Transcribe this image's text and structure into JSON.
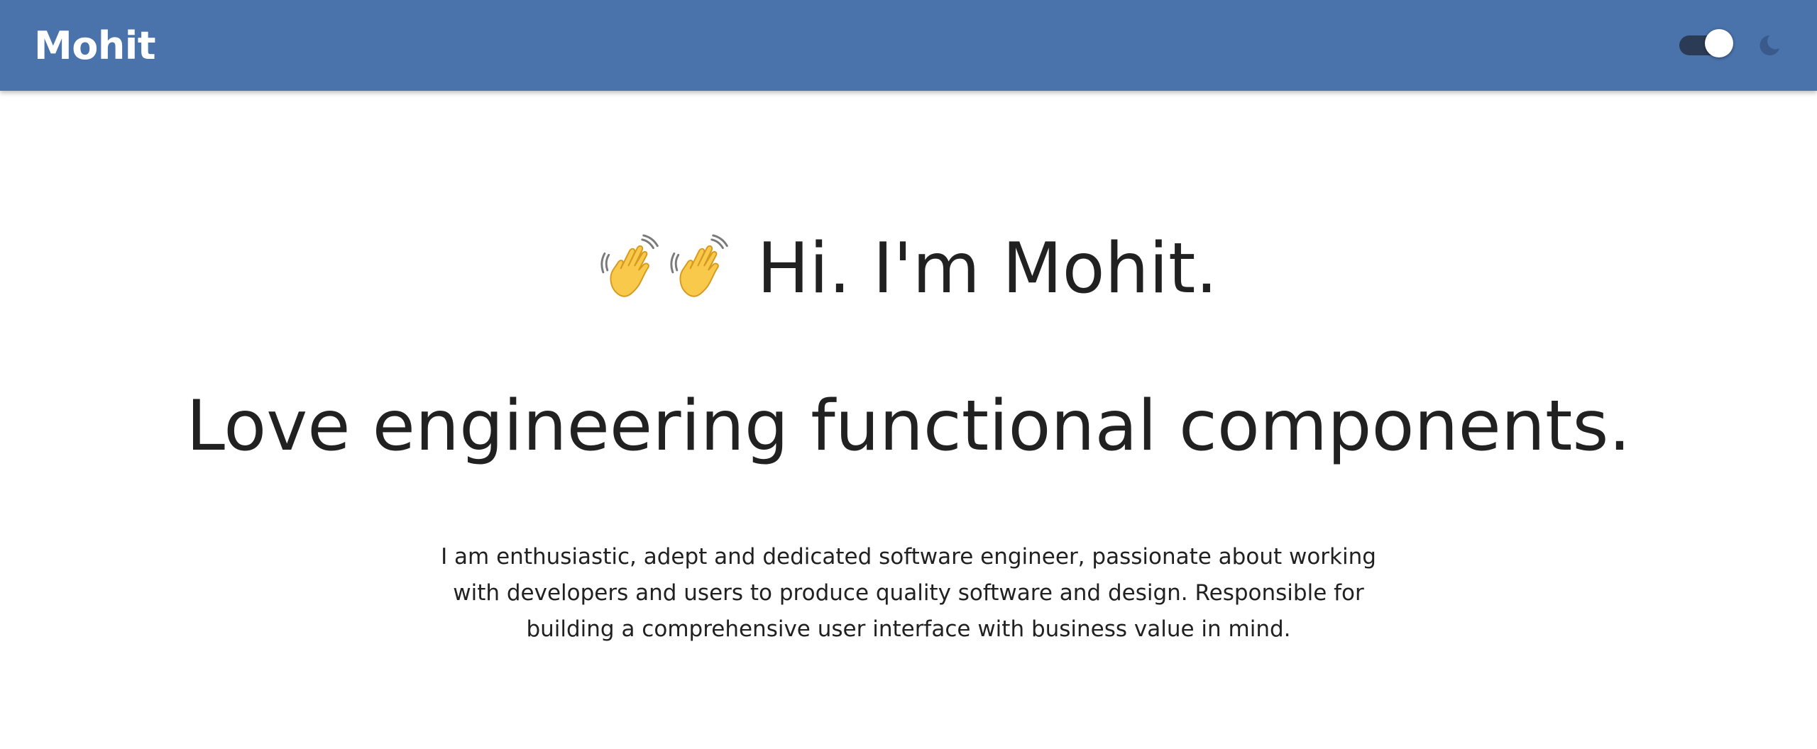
{
  "header": {
    "brand": "Mohit",
    "theme_toggle": {
      "state": "on"
    },
    "theme_icon": "moon-icon",
    "background_color": "#4a72ab"
  },
  "hero": {
    "wave_icons": [
      "waving-hand-icon",
      "waving-hand-icon"
    ],
    "greeting": "Hi. I'm Mohit.",
    "tagline": "Love engineering functional components.",
    "bio": "I am enthusiastic, adept and dedicated software engineer, passionate about working with developers and users to produce quality software and design. Responsible for building a comprehensive user interface with business value in mind."
  }
}
